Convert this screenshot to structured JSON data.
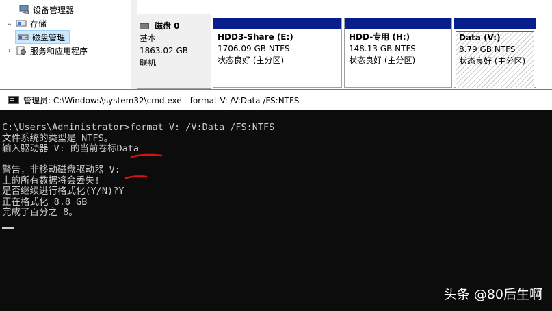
{
  "tree": {
    "items": [
      {
        "label": "设备管理器",
        "arrow": "",
        "icon": "device-manager-icon"
      },
      {
        "label": "存储",
        "arrow": "⌄",
        "icon": "storage-icon"
      },
      {
        "label": "磁盘管理",
        "arrow": "",
        "icon": "disk-management-icon",
        "selected": true
      },
      {
        "label": "服务和应用程序",
        "arrow": "›",
        "icon": "services-icon"
      }
    ]
  },
  "disk": {
    "name": "磁盘 0",
    "type": "基本",
    "size": "1863.02 GB",
    "status": "联机",
    "partitions": [
      {
        "label": "HDD3-Share  (E:)",
        "size": "1706.09 GB NTFS",
        "status": "状态良好 (主分区)"
      },
      {
        "label": "HDD-专用  (H:)",
        "size": "148.13 GB NTFS",
        "status": "状态良好 (主分区)"
      },
      {
        "label": "Data  (V:)",
        "size": "8.79 GB NTFS",
        "status": "状态良好 (主分区)"
      }
    ]
  },
  "cmd": {
    "title": "管理员: C:\\Windows\\system32\\cmd.exe - format  V: /V:Data /FS:NTFS",
    "lines": [
      "C:\\Users\\Administrator>format V: /V:Data /FS:NTFS",
      "文件系统的类型是 NTFS。",
      "输入驱动器 V: 的当前卷标Data",
      "",
      "警告，非移动磁盘驱动器 V:",
      "上的所有数据将会丢失!",
      "是否继续进行格式化(Y/N)?Y",
      "正在格式化 8.8 GB",
      "完成了百分之 8。"
    ]
  },
  "colors": {
    "partition_bar": "#081e8c",
    "console_bg": "#0c0c0c",
    "console_text": "#cccccc",
    "annotation": "#e01010"
  },
  "watermark": "头条 @80后生啊"
}
